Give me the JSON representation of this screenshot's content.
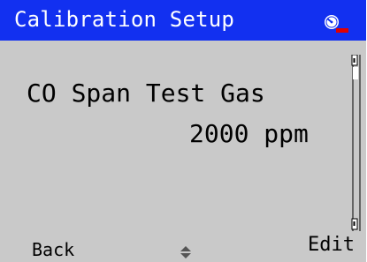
{
  "header": {
    "title": "Calibration Setup",
    "status_icon": "pump-status-icon",
    "background_color": "#1230f0",
    "status_accent_color": "#e00000"
  },
  "main": {
    "label": "CO Span Test Gas",
    "value": "2000 ppm"
  },
  "softkeys": {
    "left_label": "Back",
    "center_icon": "up-down-arrows-icon",
    "right_label": "Edit"
  },
  "screen": {
    "background_color": "#c9c9c9"
  }
}
